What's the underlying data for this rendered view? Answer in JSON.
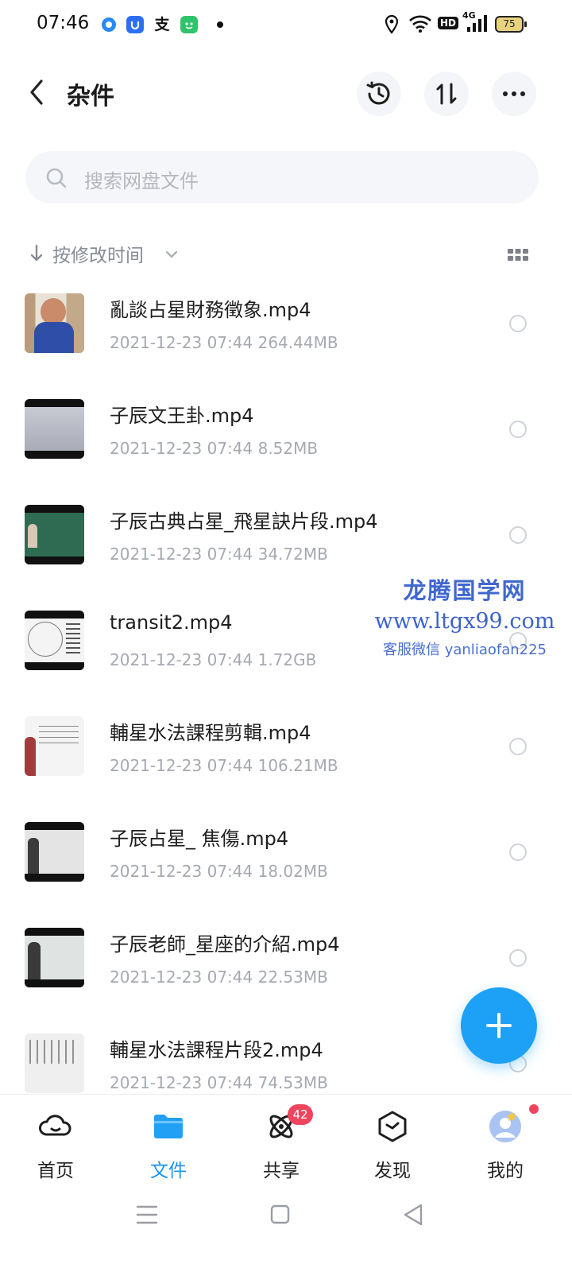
{
  "status_bar": {
    "time": "07:46",
    "battery": "75",
    "network": "4G",
    "hd": "HD",
    "apps": [
      "blue-dot-app-icon",
      "shield-app-icon",
      "alipay-icon",
      "green-app-icon"
    ]
  },
  "header": {
    "title": "杂件"
  },
  "search": {
    "placeholder": "搜索网盘文件"
  },
  "sort": {
    "label": "按修改时间"
  },
  "files": [
    {
      "name": "亂談占星財務徵象.mp4",
      "date": "2021-12-23",
      "time": "07:44",
      "size": "264.44MB"
    },
    {
      "name": "子辰文王卦.mp4",
      "date": "2021-12-23",
      "time": "07:44",
      "size": "8.52MB"
    },
    {
      "name": "子辰古典占星_飛星訣片段.mp4",
      "date": "2021-12-23",
      "time": "07:44",
      "size": "34.72MB"
    },
    {
      "name": "transit2.mp4",
      "date": "2021-12-23",
      "time": "07:44",
      "size": "1.72GB"
    },
    {
      "name": "輔星水法課程剪輯.mp4",
      "date": "2021-12-23",
      "time": "07:44",
      "size": "106.21MB"
    },
    {
      "name": "子辰占星_ 焦傷.mp4",
      "date": "2021-12-23",
      "time": "07:44",
      "size": "18.02MB"
    },
    {
      "name": "子辰老師_星座的介紹.mp4",
      "date": "2021-12-23",
      "time": "07:44",
      "size": "22.53MB"
    },
    {
      "name": "輔星水法課程片段2.mp4",
      "date": "2021-12-23",
      "time": "07:44",
      "size": "74.53MB"
    }
  ],
  "watermark": {
    "line1": "龙腾国学网",
    "line2": "www.ltgx99.com",
    "line3": "客服微信 yanliaofan225"
  },
  "bottom_nav": {
    "items": [
      {
        "label": "首页"
      },
      {
        "label": "文件"
      },
      {
        "label": "共享",
        "badge": "42"
      },
      {
        "label": "发现"
      },
      {
        "label": "我的"
      }
    ],
    "active": "文件"
  },
  "colors": {
    "accent": "#1a93f0",
    "fab": "#1da1f6",
    "badge": "#f0455f"
  }
}
